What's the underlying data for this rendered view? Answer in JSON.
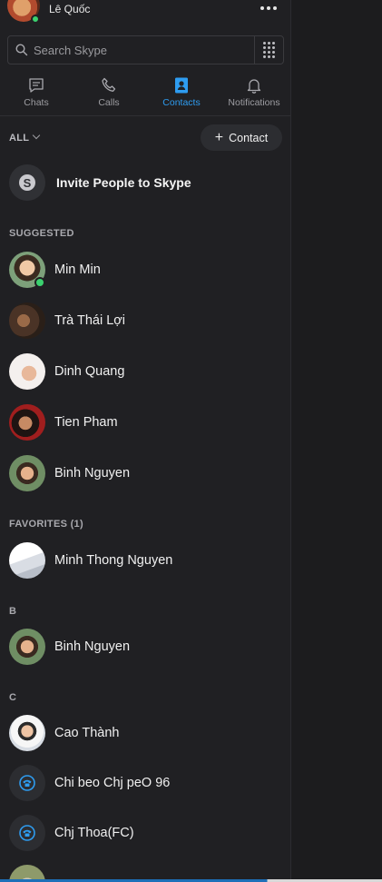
{
  "profile": {
    "name": "Lê Quốc"
  },
  "search": {
    "placeholder": "Search Skype"
  },
  "tabs": [
    {
      "label": "Chats",
      "icon": "chat-icon",
      "active": false
    },
    {
      "label": "Calls",
      "icon": "phone-icon",
      "active": false
    },
    {
      "label": "Contacts",
      "icon": "contacts-icon",
      "active": true
    },
    {
      "label": "Notifications",
      "icon": "bell-icon",
      "active": false
    }
  ],
  "filter": {
    "label": "ALL"
  },
  "add_contact": {
    "label": "Contact"
  },
  "invite": {
    "label": "Invite People to Skype"
  },
  "sections": {
    "suggested": "SUGGESTED",
    "favorites": "FAVORITES (1)",
    "b": "B",
    "c": "C"
  },
  "suggested": [
    {
      "name": "Min Min",
      "online": true
    },
    {
      "name": "Trà Thái Lợi",
      "online": false
    },
    {
      "name": "Dinh Quang",
      "online": false
    },
    {
      "name": "Tien Pham",
      "online": false
    },
    {
      "name": "Binh Nguyen",
      "online": false
    }
  ],
  "favorites": [
    {
      "name": "Minh Thong Nguyen"
    }
  ],
  "group_b": [
    {
      "name": "Binh Nguyen"
    }
  ],
  "group_c": [
    {
      "name": "Cao Thành",
      "type": "photo"
    },
    {
      "name": "Chi beo Chj peO 96",
      "type": "phone"
    },
    {
      "name": "Chj Thoa(FC)",
      "type": "phone"
    }
  ],
  "colors": {
    "accent": "#2e9cf0",
    "online": "#3bd16f",
    "background": "#202023"
  }
}
